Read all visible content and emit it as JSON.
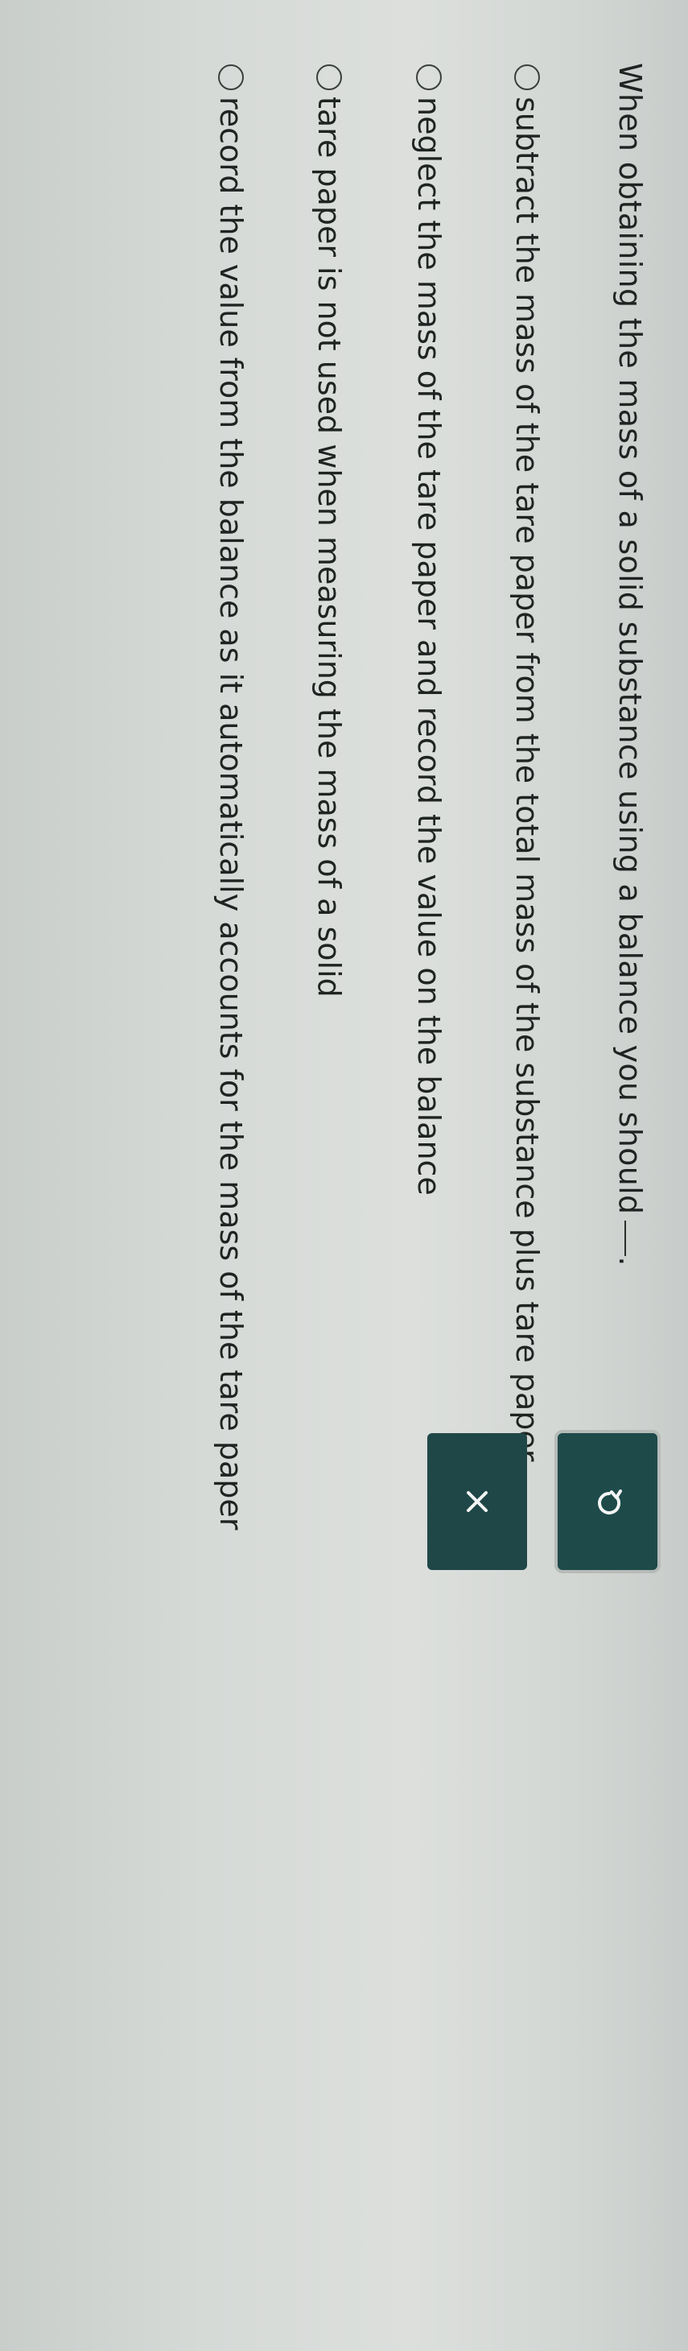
{
  "question": {
    "text": "When obtaining the mass of a solid substance using a balance you should",
    "end": "."
  },
  "options": [
    {
      "label": "subtract the mass of the tare paper from the total mass of the substance plus tare paper."
    },
    {
      "label": "neglect the mass of the tare paper and record the value on the balance"
    },
    {
      "label": "tare paper is not used when measuring the mass of a solid"
    },
    {
      "label": "record the value from the balance as it automatically accounts for the mass of the tare paper"
    }
  ],
  "buttons": {
    "reset_icon": "undo-icon",
    "clear_icon": "close-icon"
  },
  "colors": {
    "button_bg": "#1e4a4a",
    "text": "#1f2422",
    "page_bg": "#d6dad7"
  }
}
